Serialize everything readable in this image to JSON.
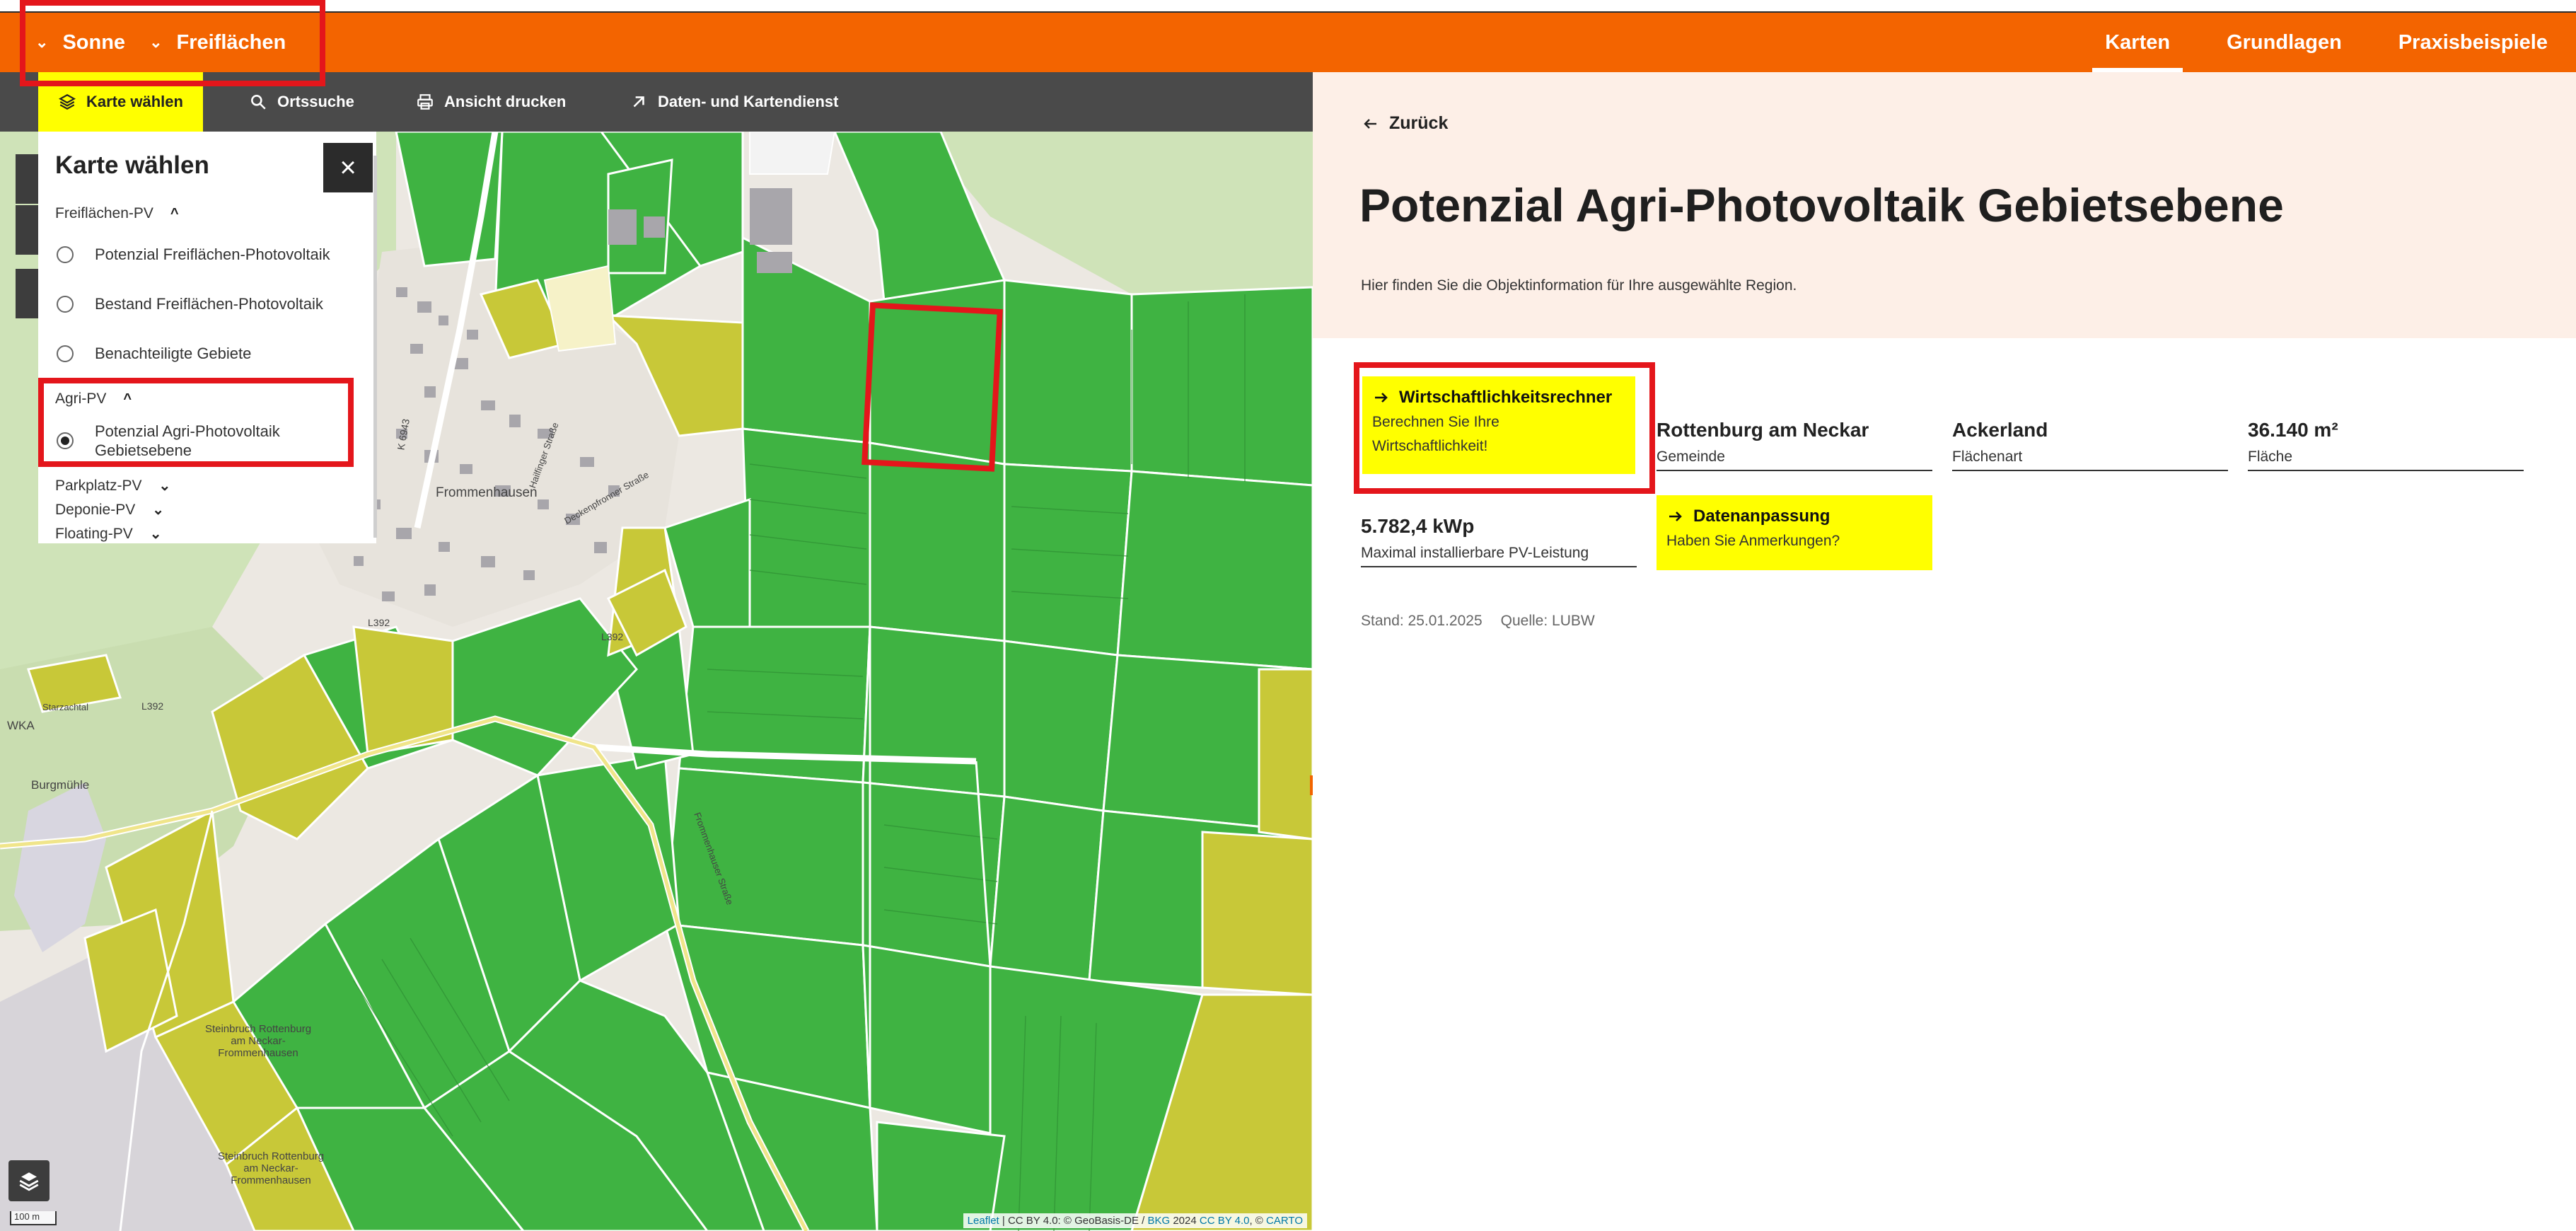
{
  "header": {
    "left_items": [
      "Sonne",
      "Freiflächen"
    ],
    "nav": [
      "Karten",
      "Grundlagen",
      "Praxisbeispiele"
    ],
    "active_nav": "Karten"
  },
  "toolbar": {
    "select_map": "Karte wählen",
    "place_search": "Ortssuche",
    "print_view": "Ansicht drucken",
    "data_service": "Daten- und Kartendienst"
  },
  "map_panel": {
    "title": "Karte wählen",
    "groups": [
      {
        "label": "Freiflächen-PV",
        "expanded": true,
        "options": [
          "Potenzial Freiflächen-Photovoltaik",
          "Bestand Freiflächen-Photovoltaik",
          "Benachteiligte Gebiete"
        ]
      },
      {
        "label": "Agri-PV",
        "expanded": true,
        "options": [
          "Potenzial Agri-Photovoltaik Gebietsebene"
        ],
        "selected": "Potenzial Agri-Photovoltaik Gebietsebene"
      },
      {
        "label": "Parkplatz-PV",
        "expanded": false
      },
      {
        "label": "Deponie-PV",
        "expanded": false
      },
      {
        "label": "Floating-PV",
        "expanded": false
      }
    ]
  },
  "map": {
    "labels": {
      "frommenhausen": "Frommenhausen",
      "burgmuehle": "Burgmühle",
      "wka": "WKA",
      "steinbruch1": "Steinbruch Rottenburg am Neckar-Frommenhausen",
      "steinbruch2": "Steinbruch Rottenburg am Neckar-Frommenhausen",
      "rd_l392a": "L392",
      "rd_l392b": "L392",
      "rd_l392c": "L392",
      "rd_k6943": "K 6943",
      "rd_hailfingerstr": "Hailfinger Straße",
      "rd_deckenpfronnerstr": "Deckenpfronner Straße",
      "rd_starzachtal": "Starzachtal",
      "rd_frommenhausenerstr": "Frommenhauser Straße"
    },
    "scale": "100 m",
    "attribution": {
      "leaflet": "Leaflet",
      "text1": " | CC BY 4.0: © GeoBasis-DE / ",
      "bkg": "BKG",
      "text2": " 2024 ",
      "cc": "CC BY 4.0",
      "text3": ", © ",
      "carto": "CARTO"
    }
  },
  "info": {
    "back": "Zurück",
    "title": "Potenzial Agri-Photovoltaik Gebietsebene",
    "subtitle": "Hier finden Sie die Objektinformation für Ihre ausgewählte Region.",
    "calc": {
      "title": "Wirtschaftlichkeitsrechner",
      "sub1": "Berechnen Sie Ihre",
      "sub2": "Wirtschaftlichkeit!"
    },
    "fields": [
      {
        "value": "Rottenburg am Neckar",
        "label": "Gemeinde"
      },
      {
        "value": "Ackerland",
        "label": "Flächenart"
      },
      {
        "value": "36.140 m²",
        "label": "Fläche"
      },
      {
        "value": "5.782,4 kWp",
        "label": "Maximal installierbare PV-Leistung"
      }
    ],
    "data_adjust": {
      "title": "Datenanpassung",
      "sub": "Haben Sie Anmerkungen?"
    },
    "stand": "Stand: 25.01.2025",
    "source": "Quelle: LUBW"
  },
  "colors": {
    "brand_orange": "#f36400",
    "toolbar": "#4a4a4a",
    "highlight_yellow": "#ffff00",
    "annotation_red": "#e4161b",
    "potential_green": "#3fb342",
    "potential_yellow": "#c8c838"
  }
}
